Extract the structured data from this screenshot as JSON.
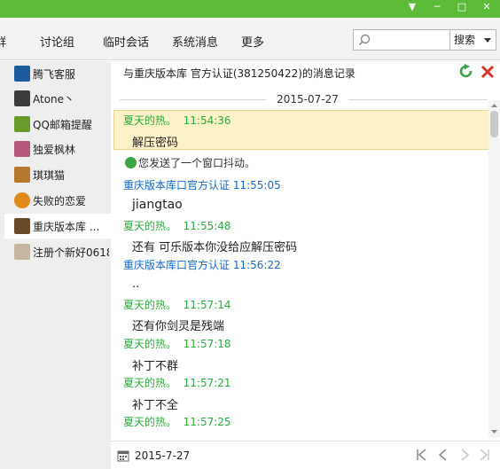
{
  "window": {
    "titlebar_color": "#5dbb3a",
    "controls": {
      "menu": "▼",
      "minimize": "─",
      "maximize": "□",
      "close": "✕"
    }
  },
  "menu": {
    "items": [
      "群",
      "讨论组",
      "临时会话",
      "系统消息",
      "更多"
    ],
    "search": {
      "value": "",
      "placeholder": "",
      "select_label": "搜索"
    }
  },
  "sidebar": {
    "items": [
      {
        "label": "腾飞客服",
        "avatar_color": "#1d5a9e",
        "icon": "tengfei-avatar-icon"
      },
      {
        "label": "Atone丶",
        "avatar_color": "#3c3c3c",
        "icon": "atone-avatar-icon"
      },
      {
        "label": "QQ邮箱提醒",
        "avatar_color": "#6a9a2a",
        "icon": "qq-mail-avatar-icon"
      },
      {
        "label": "独爱枫林",
        "avatar_color": "#b8567c",
        "icon": "maple-avatar-icon"
      },
      {
        "label": "琪琪猫",
        "avatar_color": "#b37a2e",
        "icon": "cat-avatar-icon"
      },
      {
        "label": "失败的恋爱",
        "avatar_color": "#e08a1c",
        "icon": "failed-love-avatar-icon"
      },
      {
        "label": "重庆版本库 ...",
        "avatar_color": "#6b4a2a",
        "icon": "chongqing-avatar-icon",
        "active": true
      },
      {
        "label": "注册个新好0618",
        "avatar_color": "#c6b7a2",
        "icon": "register-avatar-icon"
      }
    ]
  },
  "record": {
    "title": "与重庆版本库  官方认证(381250422)的消息记录",
    "date": "2015-07-27",
    "system_note": "您发送了一个窗口抖动。",
    "messages": [
      {
        "sender": "夏天的热。",
        "time": "11:54:36",
        "text": "解压密码",
        "color": "green"
      },
      {
        "sender": "重庆版本库口官方认证",
        "time": "11:55:05",
        "text": "jiangtao",
        "color": "blue"
      },
      {
        "sender": "夏天的热。",
        "time": "11:55:48",
        "text": "还有 可乐版本你没给应解压密码",
        "color": "green"
      },
      {
        "sender": "重庆版本库口官方认证",
        "time": "11:56:22",
        "text": "..",
        "color": "blue"
      },
      {
        "sender": "夏天的热。",
        "time": "11:57:14",
        "text": "还有你剑灵是残端",
        "color": "green"
      },
      {
        "sender": "夏天的热。",
        "time": "11:57:18",
        "text": "补丁不群",
        "color": "green"
      },
      {
        "sender": "夏天的热。",
        "time": "11:57:21",
        "text": "补丁不全",
        "color": "green"
      },
      {
        "sender": "夏天的热。",
        "time": "11:57:25",
        "text": "",
        "color": "green"
      }
    ]
  },
  "bottom": {
    "date": "2015-7-27"
  },
  "colors": {
    "accent_green": "#2eaa3e",
    "accent_blue": "#1668c8",
    "highlight": "#fdf1c8"
  }
}
